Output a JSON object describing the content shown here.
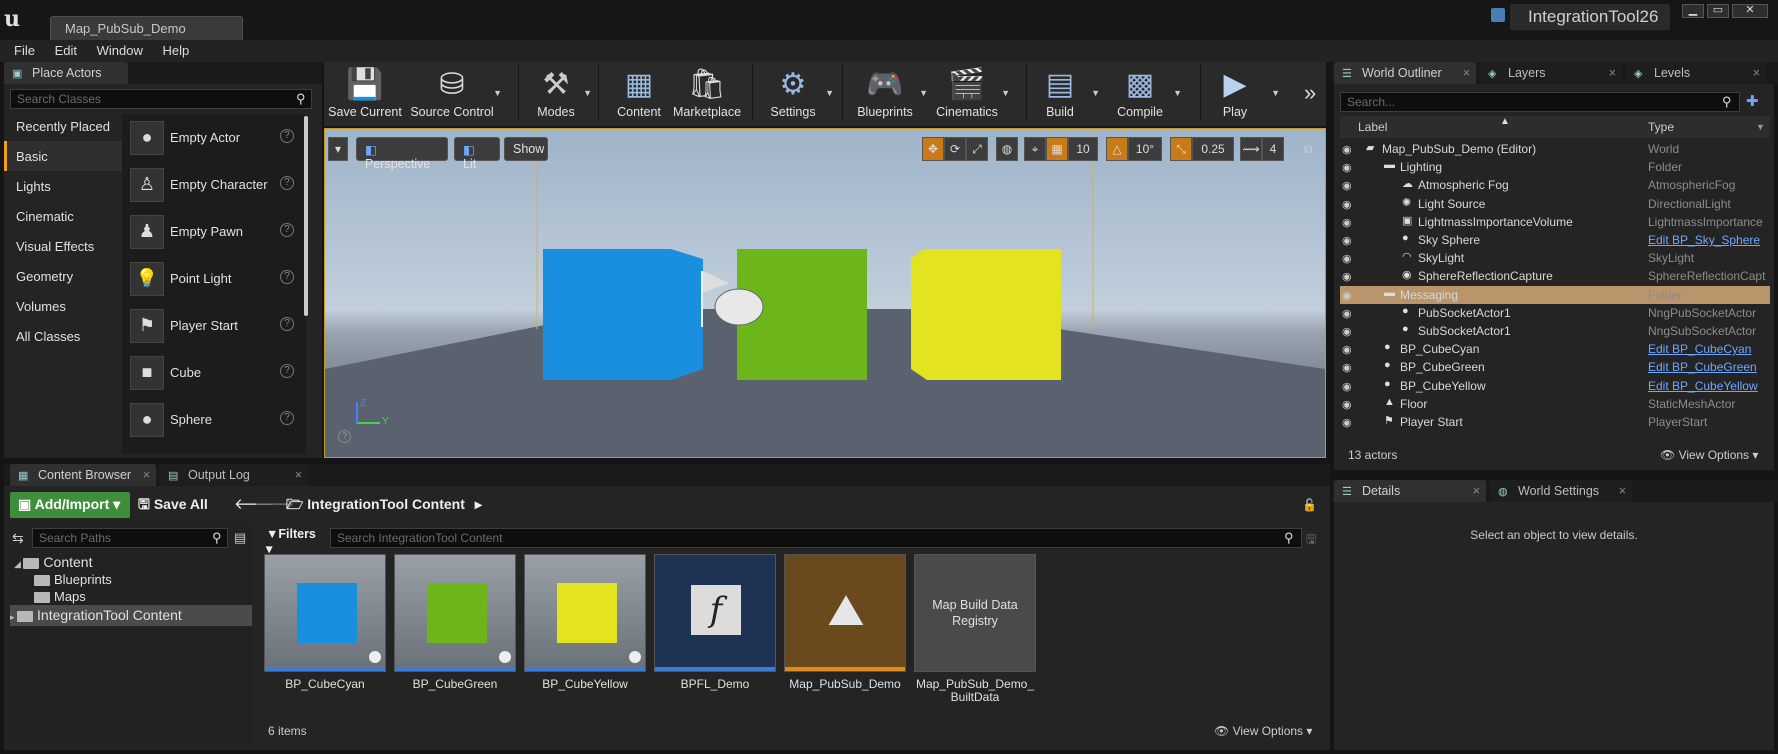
{
  "window": {
    "doc_tab": "Map_PubSub_Demo",
    "project_name": "IntegrationTool26",
    "controls": [
      "minimize",
      "maximize",
      "close"
    ]
  },
  "menu": [
    "File",
    "Edit",
    "Window",
    "Help"
  ],
  "place_actors": {
    "tab_label": "Place Actors",
    "search_placeholder": "Search Classes",
    "categories": [
      "Recently Placed",
      "Basic",
      "Lights",
      "Cinematic",
      "Visual Effects",
      "Geometry",
      "Volumes",
      "All Classes"
    ],
    "selected_category": "Basic",
    "actors": [
      "Empty Actor",
      "Empty Character",
      "Empty Pawn",
      "Point Light",
      "Player Start",
      "Cube",
      "Sphere"
    ]
  },
  "toolbar": {
    "buttons": [
      "Save Current",
      "Source Control",
      "Modes",
      "Content",
      "Marketplace",
      "Settings",
      "Blueprints",
      "Cinematics",
      "Build",
      "Compile",
      "Play"
    ],
    "more": "»"
  },
  "viewport": {
    "menu_caret": "▾",
    "perspective": "Perspective",
    "lit": "Lit",
    "show": "Show",
    "grid_snap": "10",
    "rotation_snap": "10°",
    "scale_snap": "0.25",
    "camera_speed": "4",
    "axis_z": "Z",
    "axis_y": "Y",
    "cube_colors": {
      "cyan": "#1a8fe0",
      "green": "#6cb51a",
      "yellow": "#e3e31f"
    }
  },
  "outliner": {
    "tabs": [
      "World Outliner",
      "Layers",
      "Levels"
    ],
    "search_placeholder": "Search...",
    "col_label": "Label",
    "col_type": "Type",
    "rows": [
      {
        "label": "Map_PubSub_Demo (Editor)",
        "type": "World",
        "link": false
      },
      {
        "label": "Lighting",
        "type": "Folder",
        "link": false
      },
      {
        "label": "Atmospheric Fog",
        "type": "AtmosphericFog",
        "link": false
      },
      {
        "label": "Light Source",
        "type": "DirectionalLight",
        "link": false
      },
      {
        "label": "LightmassImportanceVolume",
        "type": "LightmassImportance",
        "link": false
      },
      {
        "label": "Sky Sphere",
        "type": "Edit BP_Sky_Sphere",
        "link": true
      },
      {
        "label": "SkyLight",
        "type": "SkyLight",
        "link": false
      },
      {
        "label": "SphereReflectionCapture",
        "type": "SphereReflectionCapt",
        "link": false
      },
      {
        "label": "Messaging",
        "type": "Folder",
        "link": false
      },
      {
        "label": "PubSocketActor1",
        "type": "NngPubSocketActor",
        "link": false
      },
      {
        "label": "SubSocketActor1",
        "type": "NngSubSocketActor",
        "link": false
      },
      {
        "label": "BP_CubeCyan",
        "type": "Edit BP_CubeCyan",
        "link": true
      },
      {
        "label": "BP_CubeGreen",
        "type": "Edit BP_CubeGreen",
        "link": true
      },
      {
        "label": "BP_CubeYellow",
        "type": "Edit BP_CubeYellow",
        "link": true
      },
      {
        "label": "Floor",
        "type": "StaticMeshActor",
        "link": false
      },
      {
        "label": "Player Start",
        "type": "PlayerStart",
        "link": false
      }
    ],
    "actor_count": "13 actors",
    "view_options": "View Options"
  },
  "details": {
    "tabs": [
      "Details",
      "World Settings"
    ],
    "empty_message": "Select an object to view details."
  },
  "content_browser": {
    "tabs": [
      "Content Browser",
      "Output Log"
    ],
    "add_import": "Add/Import",
    "save_all": "Save All",
    "path": "IntegrationTool Content",
    "search_paths_placeholder": "Search Paths",
    "filters": "Filters",
    "search_placeholder": "Search IntegrationTool Content",
    "tree": [
      "Content",
      "Blueprints",
      "Maps",
      "IntegrationTool Content"
    ],
    "assets": [
      "BP_CubeCyan",
      "BP_CubeGreen",
      "BP_CubeYellow",
      "BPFL_Demo",
      "Map_PubSub_Demo",
      "Map_PubSub_Demo_\nBuiltData"
    ],
    "asset_thumb_text": "Map Build Data Registry",
    "item_count": "6 items",
    "view_options": "View Options"
  }
}
